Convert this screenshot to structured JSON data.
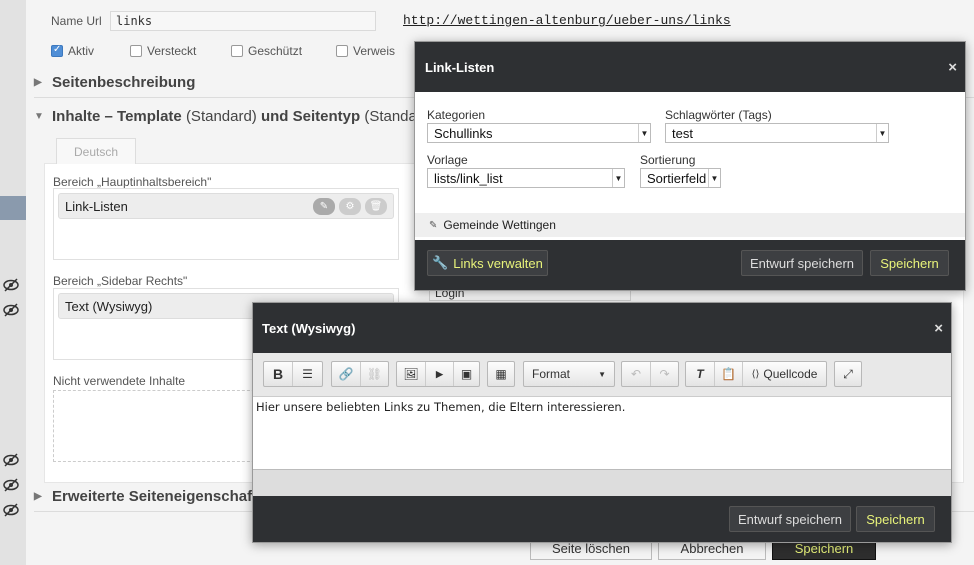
{
  "page": {
    "name_url_label": "Name Url",
    "name_url_value": "links",
    "url_link": "http://wettingen-altenburg/ueber-uns/links",
    "checkboxes": [
      {
        "label": "Aktiv",
        "checked": true
      },
      {
        "label": "Versteckt",
        "checked": false
      },
      {
        "label": "Geschützt",
        "checked": false
      },
      {
        "label": "Verweis",
        "checked": false
      }
    ],
    "section_seitenbeschreibung": "Seitenbeschreibung",
    "section_inhalte_bold1": "Inhalte – Template",
    "section_inhalte_light1": "(Standard)",
    "section_inhalte_bold2": "und Seitentyp",
    "section_inhalte_light2": "(Standard",
    "tab_deutsch": "Deutsch",
    "bereich_haupt_label": "Bereich „Hauptinhaltsbereich\"",
    "bereich_haupt_item": "Link-Listen",
    "bereich_sidebar_label": "Bereich „Sidebar Rechts\"",
    "bereich_sidebar_item": "Text (Wysiwyg)",
    "nicht_verwendet_label": "Nicht verwendete Inhalte",
    "login_field": "Login",
    "section_erweitert": "Erweiterte Seiteneigenschafte",
    "btn_seite_loeschen": "Seite löschen",
    "btn_abbrechen": "Abbrechen",
    "btn_speichern": "Speichern"
  },
  "modal_links": {
    "title": "Link-Listen",
    "close": "×",
    "kategorien_label": "Kategorien",
    "kategorien_value": "Schullinks",
    "tags_label": "Schlagwörter (Tags)",
    "tags_value": "test",
    "vorlage_label": "Vorlage",
    "vorlage_value": "lists/link_list",
    "sortierung_label": "Sortierung",
    "sortierung_value": "Sortierfeld",
    "gemeinde": "Gemeinde Wettingen",
    "links_verwalten": "Links verwalten",
    "entwurf_speichern": "Entwurf speichern",
    "speichern": "Speichern"
  },
  "modal_text": {
    "title": "Text (Wysiwyg)",
    "close": "×",
    "toolbar": {
      "bold": "B",
      "format": "Format",
      "quellcode": "Quellcode"
    },
    "content": "Hier unsere beliebten Links zu Themen, die Eltern interessieren.",
    "entwurf_speichern": "Entwurf speichern",
    "speichern": "Speichern"
  },
  "colors": {
    "accent_text": "#e8f37a",
    "modal_header": "#2e3033",
    "checkbox_on": "#4f8ed6"
  }
}
